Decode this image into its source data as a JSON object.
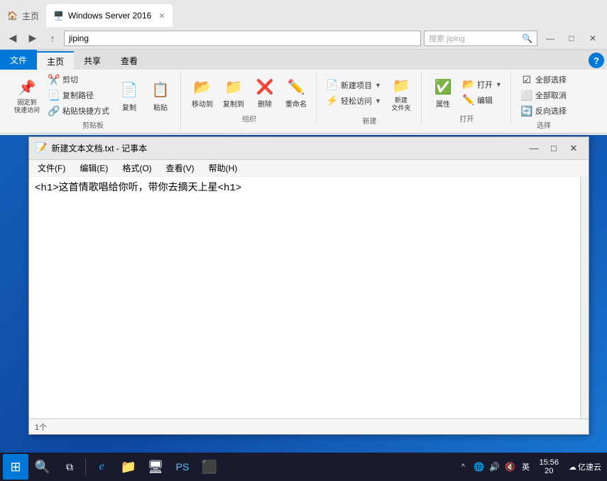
{
  "browser": {
    "tabs": [
      {
        "label": "主页",
        "active": false,
        "icon": "🏠"
      },
      {
        "label": "Windows Server 2016",
        "active": true,
        "icon": "🖥️"
      }
    ]
  },
  "explorer": {
    "title": "jiping",
    "path": "jiping",
    "ribbon_tabs": [
      "文件",
      "主页",
      "共享",
      "查看"
    ],
    "active_tab": "主页",
    "groups": {
      "clipboard": {
        "label": "剪贴板",
        "buttons": [
          {
            "label": "固定到\n快速访问",
            "icon": "📌"
          },
          {
            "label": "复制",
            "icon": "📄"
          },
          {
            "label": "粘贴",
            "icon": "📋"
          }
        ],
        "small_btns": [
          {
            "label": "剪切",
            "icon": "✂️"
          },
          {
            "label": "复制路径",
            "icon": "📃"
          },
          {
            "label": "粘贴快捷方式",
            "icon": "🔗"
          }
        ]
      },
      "organize": {
        "label": "组织",
        "buttons": [
          {
            "label": "移动到",
            "icon": "📂"
          },
          {
            "label": "复制到",
            "icon": "📁"
          },
          {
            "label": "删除",
            "icon": "❌"
          },
          {
            "label": "重命名",
            "icon": "✏️"
          }
        ]
      },
      "new": {
        "label": "新建",
        "buttons": [
          {
            "label": "新建\n文件夹",
            "icon": "📁"
          }
        ],
        "small_btns": [
          {
            "label": "新建项目",
            "icon": "📄"
          },
          {
            "label": "轻松访问",
            "icon": "⚡"
          }
        ]
      },
      "open": {
        "label": "打开",
        "buttons": [
          {
            "label": "属性",
            "icon": "🔧"
          }
        ],
        "small_btns": [
          {
            "label": "打开",
            "icon": "📂"
          },
          {
            "label": "编辑",
            "icon": "✏️"
          }
        ]
      },
      "select": {
        "label": "选择",
        "small_btns": [
          {
            "label": "全部选择",
            "icon": "☑"
          },
          {
            "label": "全部取消",
            "icon": "⬜"
          },
          {
            "label": "反向选择",
            "icon": "🔄"
          }
        ]
      }
    },
    "help_label": "?"
  },
  "notepad": {
    "title": "新建文本文档.txt - 记事本",
    "icon": "📝",
    "content": "<h1>这首情歌唱给你听，带你去摘天上星<h1>",
    "menu": [
      "文件(F)",
      "编辑(E)",
      "格式(O)",
      "查看(V)",
      "帮助(H)"
    ],
    "statusbar": "1个"
  },
  "taskbar": {
    "items": [
      {
        "label": "开始",
        "icon": "⊞"
      },
      {
        "label": "搜索",
        "icon": "🔍"
      },
      {
        "label": "任务视图",
        "icon": "⧉"
      },
      {
        "label": "IE浏览器",
        "icon": "ℯ"
      },
      {
        "label": "文件资源管理器",
        "icon": "📁"
      },
      {
        "label": "控制面板",
        "icon": "🖥"
      },
      {
        "label": "PowerShell",
        "icon": "🔷"
      },
      {
        "label": "命令提示符",
        "icon": "⬛"
      }
    ],
    "tray": {
      "chevron": "^",
      "network": "🌐",
      "volume": "🔊",
      "lang": "英",
      "time": "15:56",
      "date": "20",
      "brand": "亿速云"
    }
  }
}
